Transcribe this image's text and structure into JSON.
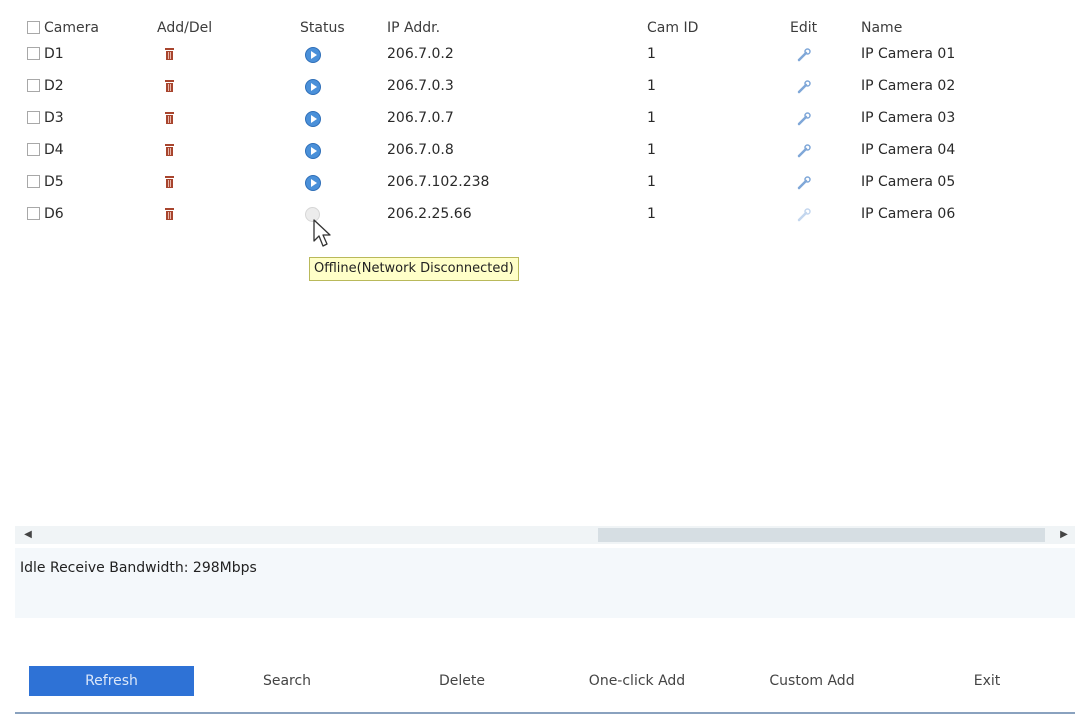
{
  "table": {
    "headers": {
      "camera": "Camera",
      "add_del": "Add/Del",
      "status": "Status",
      "ip": "IP Addr.",
      "cam_id": "Cam ID",
      "edit": "Edit",
      "name": "Name"
    },
    "rows": [
      {
        "camera": "D1",
        "ip": "206.7.0.2",
        "cam_id": "1",
        "name": "IP Camera 01",
        "status": "online"
      },
      {
        "camera": "D2",
        "ip": "206.7.0.3",
        "cam_id": "1",
        "name": "IP Camera 02",
        "status": "online"
      },
      {
        "camera": "D3",
        "ip": "206.7.0.7",
        "cam_id": "1",
        "name": "IP Camera 03",
        "status": "online"
      },
      {
        "camera": "D4",
        "ip": "206.7.0.8",
        "cam_id": "1",
        "name": "IP Camera 04",
        "status": "online"
      },
      {
        "camera": "D5",
        "ip": "206.7.102.238",
        "cam_id": "1",
        "name": "IP Camera 05",
        "status": "online"
      },
      {
        "camera": "D6",
        "ip": "206.2.25.66",
        "cam_id": "1",
        "name": "IP Camera 06",
        "status": "offline"
      }
    ]
  },
  "tooltip": "Offline(Network Disconnected)",
  "bandwidth": "Idle Receive Bandwidth: 298Mbps",
  "buttons": {
    "refresh": "Refresh",
    "search": "Search",
    "delete": "Delete",
    "one_click_add": "One-click Add",
    "custom_add": "Custom Add",
    "exit": "Exit"
  },
  "icons": {
    "delete": "trash-icon",
    "status_online": "play-circle-icon",
    "status_offline": "offline-dot-icon",
    "edit": "wrench-icon",
    "scroll_left": "arrow-left-icon",
    "scroll_right": "arrow-right-icon"
  },
  "colors": {
    "primary_button": "#2e72d6",
    "status_online": "#4a90d9",
    "trash": "#a8452e",
    "edit": "#7fa7d8",
    "tooltip_bg": "#ffffc8"
  }
}
